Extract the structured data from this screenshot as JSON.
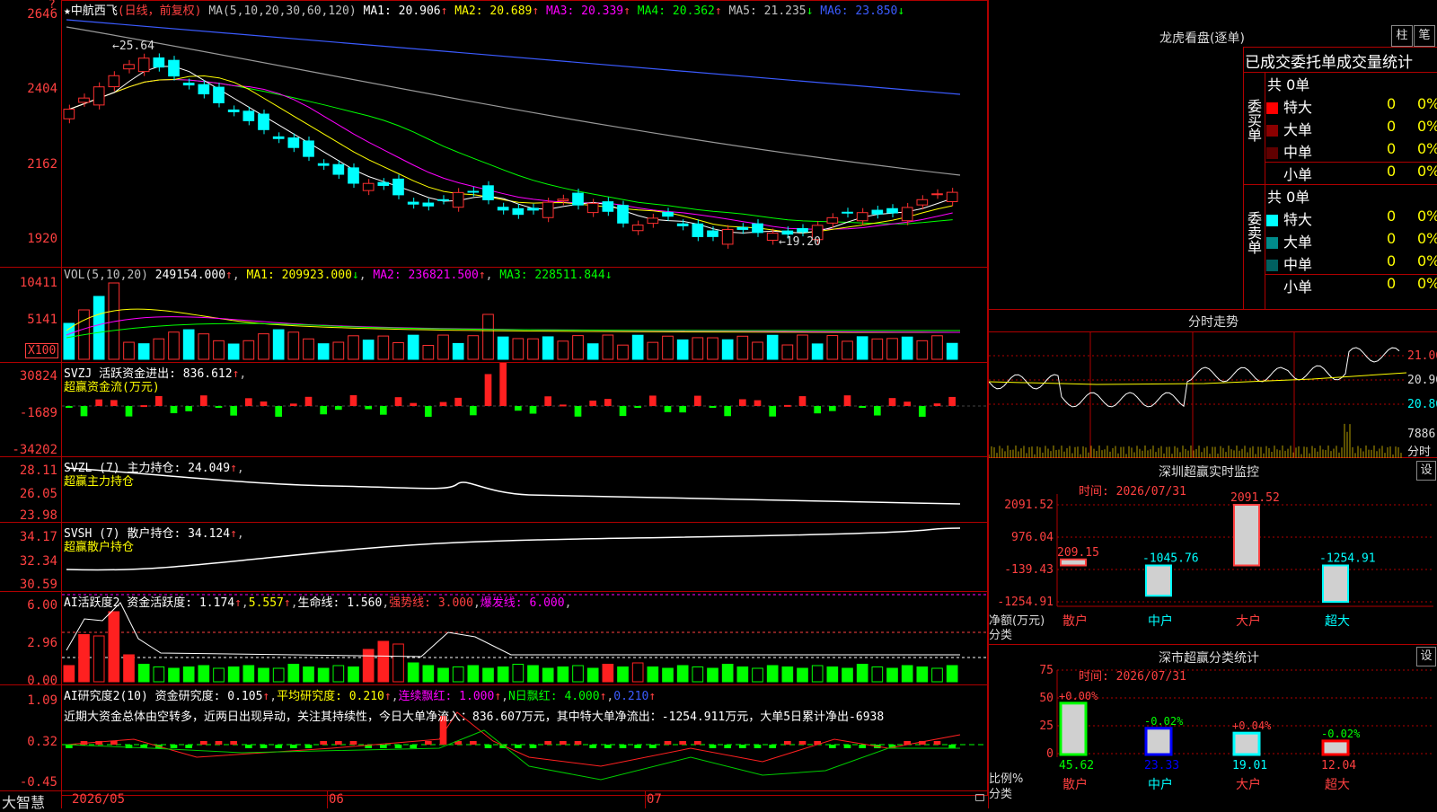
{
  "main": {
    "star": "★",
    "name": "中航西飞",
    "period": "(日线，前复权)",
    "ma_prefix": "MA(5,10,20,30,60,120)",
    "ma": [
      {
        "label": "MA1:",
        "value": "20.906",
        "arrow": "↑",
        "color": "#ffffff"
      },
      {
        "label": "MA2:",
        "value": "20.689",
        "arrow": "↑",
        "color": "#ffff00"
      },
      {
        "label": "MA3:",
        "value": "20.339",
        "arrow": "↑",
        "color": "#ff00ff"
      },
      {
        "label": "MA4:",
        "value": "20.362",
        "arrow": "↑",
        "color": "#00ff00"
      },
      {
        "label": "MA5:",
        "value": "21.235",
        "arrow": "↓",
        "color": "#c0c0c0"
      },
      {
        "label": "MA6:",
        "value": "23.850",
        "arrow": "↓",
        "color": "#3b5bff"
      }
    ],
    "y_ticks": [
      "2646",
      "2404",
      "2162",
      "1920"
    ],
    "high_annot": "←25.64",
    "low_annot": "←19.20",
    "corner_mark": "?"
  },
  "vol": {
    "header": "VOL(5,10,20)",
    "value": "249154.000",
    "ma1": "MA1: 209923.000",
    "ma2": "MA2: 236821.500",
    "ma3": "MA3: 228511.844",
    "y_ticks": [
      "10411",
      "5141"
    ],
    "unit": "X100"
  },
  "svzj": {
    "header": "SVZJ  活跃资金进出: 836.612",
    "sub": "超赢资金流(万元)",
    "y_ticks": [
      "30824",
      "-1689",
      "-34202"
    ]
  },
  "svzl": {
    "header": "SVZL (7) 主力持仓: 24.049",
    "sub": "超赢主力持仓",
    "y_ticks": [
      "28.11",
      "26.05",
      "23.98"
    ]
  },
  "svsh": {
    "header": "SVSH (7) 散户持仓: 34.124",
    "sub": "超赢散户持仓",
    "y_ticks": [
      "34.17",
      "32.34",
      "30.59"
    ]
  },
  "ai1": {
    "header": "AI活跃度2 资金活跃度: 1.174",
    "v2": "5.557",
    "life": "生命线: 1.560",
    "strong": "强势线: 3.000",
    "burst": "爆发线: 6.000",
    "y_ticks": [
      "6.00",
      "2.96",
      "0.00"
    ]
  },
  "ai2": {
    "header": "AI研究度2(10) 资金研究度: 0.105",
    "avg": "平均研究度: 0.210",
    "cont": "连续飘红: 1.000",
    "n": "N日飘红: 4.000",
    "last": "0.210",
    "comment": "近期大资金总体由空转多，近两日出现异动，关注其持续性，今日大单净流入：836.607万元，其中特大单净流出：-1254.911万元，大单5日累计净出-6938",
    "y_ticks": [
      "1.09",
      "0.32",
      "-0.45"
    ]
  },
  "bottom": {
    "brand": "大智慧",
    "dates": [
      "2026/05",
      "06",
      "07"
    ]
  },
  "lhb": {
    "title": "龙虎看盘(逐单)",
    "btn1": "柱",
    "btn2": "笔",
    "tabs": "已成交委托单成交量统计",
    "buy_label": "委买单",
    "sell_label": "委卖单",
    "buy_total": "共 0单",
    "sell_total": "共 0单",
    "rows": [
      {
        "name": "特大",
        "count": "0",
        "pct": "0%"
      },
      {
        "name": "大单",
        "count": "0",
        "pct": "0%"
      },
      {
        "name": "中单",
        "count": "0",
        "pct": "0%"
      },
      {
        "name": "小单",
        "count": "0",
        "pct": "0%"
      }
    ],
    "buy_colors": [
      "#ff0000",
      "#8b0000",
      "#600000",
      ""
    ],
    "sell_colors": [
      "#00ffff",
      "#008b8b",
      "#006060",
      ""
    ]
  },
  "intraday": {
    "title": "分时走势",
    "ticks": [
      "21.06",
      "20.96",
      "20.86"
    ],
    "vol_tick": "7886",
    "vol_unit": "分时"
  },
  "monitor": {
    "title": "深圳超赢实时监控",
    "set": "设",
    "time": "时间: 2026/07/31",
    "y_ticks": [
      "2091.52",
      "976.04",
      "-139.43",
      "-1254.91"
    ],
    "ylabel1": "净额(万元)",
    "ylabel2": "分类",
    "bars": [
      {
        "cat": "散户",
        "value": "209.15",
        "cat_color": "#ff4040"
      },
      {
        "cat": "中户",
        "value": "-1045.76",
        "cat_color": "#00ffff"
      },
      {
        "cat": "大户",
        "value": "2091.52",
        "cat_color": "#ff4040"
      },
      {
        "cat": "超大",
        "value": "-1254.91",
        "cat_color": "#00ffff"
      }
    ]
  },
  "stats": {
    "title": "深市超赢分类统计",
    "set": "设",
    "time": "时间: 2026/07/31",
    "y_ticks": [
      "75",
      "50",
      "25",
      "0"
    ],
    "ylabel1": "比例%",
    "ylabel2": "分类",
    "bars": [
      {
        "cat": "散户",
        "pct": "+0.00%",
        "value": "45.62",
        "num": 45.62,
        "color": "#00ff00",
        "cat_color": "#ff4040"
      },
      {
        "cat": "中户",
        "pct": "-0.02%",
        "value": "23.33",
        "num": 23.33,
        "color": "#0000ff",
        "cat_color": "#00ffff"
      },
      {
        "cat": "大户",
        "pct": "+0.04%",
        "value": "19.01",
        "num": 19.01,
        "color": "#00ffff",
        "cat_color": "#ff4040"
      },
      {
        "cat": "超大",
        "pct": "-0.02%",
        "value": "12.04",
        "num": 12.04,
        "color": "#ff0000",
        "cat_color": "#ff4040"
      }
    ]
  }
}
